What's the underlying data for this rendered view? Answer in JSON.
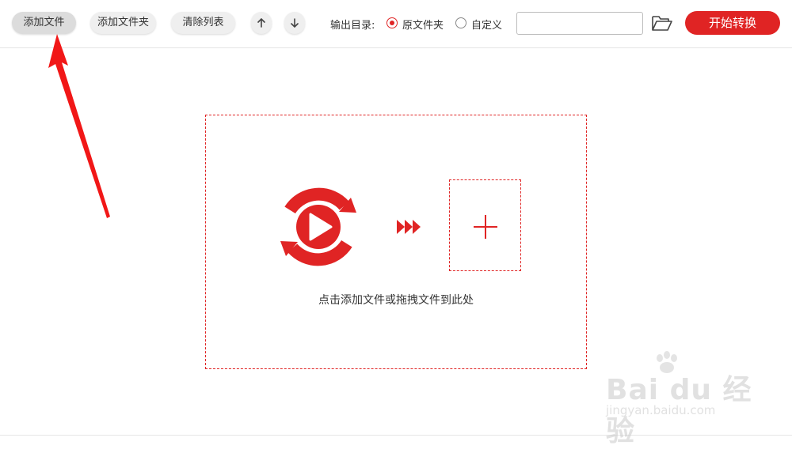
{
  "toolbar": {
    "add_file": "添加文件",
    "add_folder": "添加文件夹",
    "clear_list": "清除列表",
    "output_dir_label": "输出目录:",
    "option_source_folder": "原文件夹",
    "option_custom": "自定义",
    "path_value": "",
    "start_label": "开始转换"
  },
  "drop_area": {
    "hint": "点击添加文件或拖拽文件到此处"
  },
  "watermark": {
    "brand": "Bai du 经验",
    "url": "jingyan.baidu.com"
  },
  "icons": {
    "up": "arrow-up-icon",
    "down": "arrow-down-icon",
    "folder": "folder-open-icon",
    "logo": "video-convert-logo-icon",
    "forward": "triple-chevron-icon",
    "plus": "plus-icon"
  },
  "colors": {
    "accent": "#e02424",
    "button_bg": "#efefef",
    "border": "#bdbdbd"
  }
}
